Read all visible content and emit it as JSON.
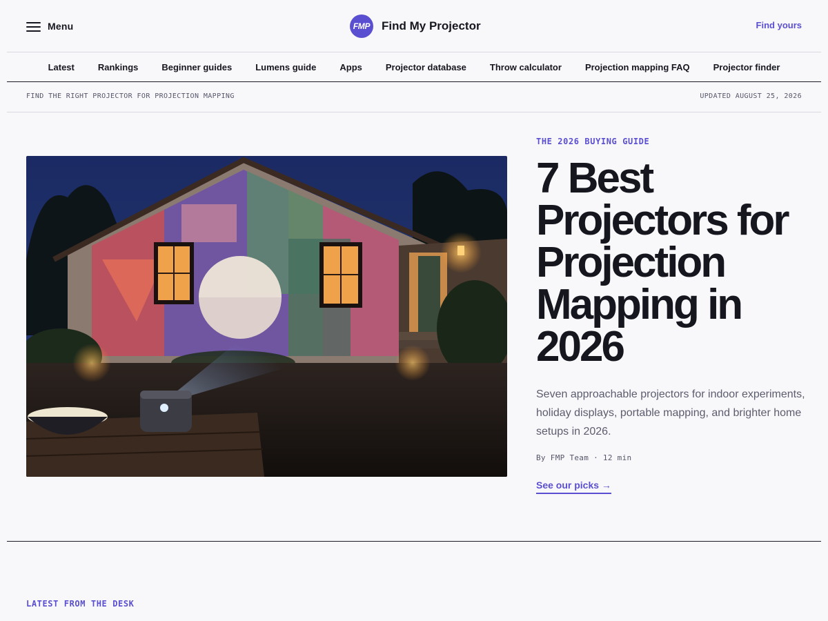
{
  "header": {
    "menu_label": "Menu",
    "logo_text": "FMP",
    "brand_name": "Find My Projector",
    "cta_label": "Find yours",
    "menu_icon": "hamburger-icon"
  },
  "nav": {
    "items": [
      "Latest",
      "Rankings",
      "Beginner guides",
      "Lumens guide",
      "Apps",
      "Projector database",
      "Throw calculator",
      "Projection mapping FAQ",
      "Projector finder"
    ]
  },
  "subbar": {
    "tagline": "FIND THE RIGHT PROJECTOR FOR PROJECTION MAPPING",
    "updated": "UPDATED AUGUST 25, 2026"
  },
  "hero": {
    "kicker": "THE 2026 BUYING GUIDE",
    "headline": "7 Best Projectors for Projection Mapping in 2026",
    "dek": "Seven approachable projectors for indoor experiments, holiday displays, portable mapping, and brighter home setups in 2026.",
    "byline": "By FMP Team · 12 min",
    "cta": "See our picks →"
  },
  "latest": {
    "label": "LATEST FROM THE DESK"
  },
  "colors": {
    "accent": "#5a4fd0",
    "background": "#f8f8fb",
    "text": "#16161f"
  }
}
